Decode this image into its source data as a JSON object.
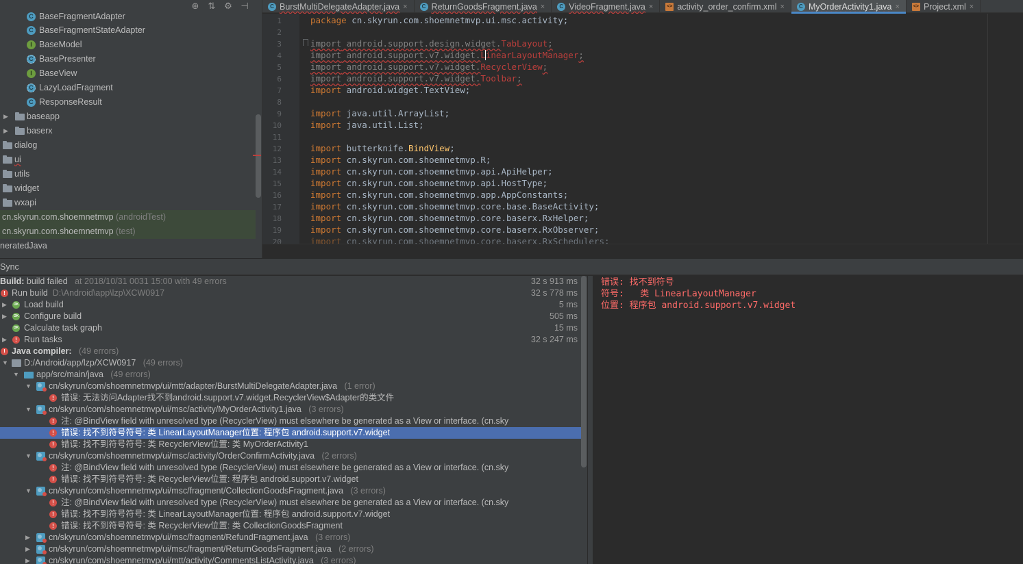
{
  "project_tree": {
    "toolbar_icons": [
      "target-icon",
      "collapse-icon",
      "gear-icon",
      "hide-icon"
    ],
    "items": [
      {
        "label": "BaseFragmentAdapter",
        "icon": "class-icon",
        "sub": ""
      },
      {
        "label": "BaseFragmentStateAdapter",
        "icon": "class-icon",
        "sub": ""
      },
      {
        "label": "BaseModel",
        "icon": "interface-icon",
        "sub": ""
      },
      {
        "label": "BasePresenter",
        "icon": "abstract-class-icon",
        "sub": ""
      },
      {
        "label": "BaseView",
        "icon": "interface-icon",
        "sub": ""
      },
      {
        "label": "LazyLoadFragment",
        "icon": "abstract-class-icon",
        "sub": ""
      },
      {
        "label": "ResponseResult",
        "icon": "class-icon",
        "sub": ""
      },
      {
        "label": "baseapp",
        "icon": "folder-icon",
        "sub": ""
      },
      {
        "label": "baserx",
        "icon": "folder-icon",
        "sub": ""
      },
      {
        "label": "dialog",
        "icon": "folder-icon",
        "sub": ""
      },
      {
        "label": "ui",
        "icon": "folder-icon",
        "sub": ""
      },
      {
        "label": "utils",
        "icon": "folder-icon",
        "sub": ""
      },
      {
        "label": "widget",
        "icon": "folder-icon",
        "sub": ""
      },
      {
        "label": "wxapi",
        "icon": "folder-icon",
        "sub": ""
      },
      {
        "label": "cn.skyrun.com.shoemnetmvp",
        "icon": "",
        "sub": "(androidTest)"
      },
      {
        "label": "cn.skyrun.com.shoemnetmvp",
        "icon": "",
        "sub": "(test)"
      },
      {
        "label": "neratedJava",
        "icon": "",
        "sub": ""
      }
    ]
  },
  "editor": {
    "tabs": [
      {
        "label": "BurstMultiDelegateAdapter.java",
        "icon": "class-icon",
        "active": false
      },
      {
        "label": "ReturnGoodsFragment.java",
        "icon": "class-icon",
        "active": false
      },
      {
        "label": "VideoFragment.java",
        "icon": "class-icon",
        "active": false
      },
      {
        "label": "activity_order_confirm.xml",
        "icon": "xml-icon",
        "active": false
      },
      {
        "label": "MyOrderActivity1.java",
        "icon": "class-icon",
        "active": true
      },
      {
        "label": "Project.xml",
        "icon": "xml-icon",
        "active": false
      }
    ],
    "close_glyph": "×",
    "line_numbers": [
      "1",
      "2",
      "3",
      "4",
      "5",
      "6",
      "7",
      "8",
      "9",
      "10",
      "11",
      "12",
      "13",
      "14",
      "15",
      "16",
      "17",
      "18",
      "19",
      "20"
    ],
    "code": {
      "l1_kw": "package",
      "l1": " cn.skyrun.com.shoemnetmvp.ui.msc.activity;",
      "l3_kw": "import",
      "l3": " android.support.design.widget.",
      "l3_err": "TabLayout",
      "l4_kw": "import",
      "l4": " android.support.v7.widget.",
      "l4_err": "LinearLayoutManager",
      "l5_kw": "import",
      "l5": " android.support.v7.widget.",
      "l5_err": "RecyclerView",
      "l6_kw": "import",
      "l6": " android.support.v7.widget.",
      "l6_err": "Toolbar",
      "l7_kw": "import",
      "l7": " android.widget.TextView;",
      "l9_kw": "import",
      "l9": " java.util.ArrayList;",
      "l10_kw": "import",
      "l10": " java.util.List;",
      "l12_kw": "import",
      "l12": " butterknife.",
      "l12_sym": "BindView",
      "l13_kw": "import",
      "l13": " cn.skyrun.com.shoemnetmvp.R;",
      "l14_kw": "import",
      "l14": " cn.skyrun.com.shoemnetmvp.api.ApiHelper;",
      "l15_kw": "import",
      "l15": " cn.skyrun.com.shoemnetmvp.api.HostType;",
      "l16_kw": "import",
      "l16": " cn.skyrun.com.shoemnetmvp.app.AppConstants;",
      "l17_kw": "import",
      "l17": " cn.skyrun.com.shoemnetmvp.core.base.BaseActivity;",
      "l18_kw": "import",
      "l18": " cn.skyrun.com.shoemnetmvp.core.baserx.RxHelper;",
      "l19_kw": "import",
      "l19": " cn.skyrun.com.shoemnetmvp.core.baserx.RxObserver;",
      "l20_kw": "import",
      "l20": " cn.skyrun.com.shoemnetmvp.core.baserx.RxSchedulers;"
    }
  },
  "build": {
    "header": "Sync",
    "rows": [
      {
        "label": "Build:",
        "rest": "build failed",
        "sub": "at 2018/10/31 0031 15:00   with 49 errors",
        "time": "32 s 913 ms"
      },
      {
        "label": "Run build",
        "sub": "D:\\Android\\app\\lzp\\XCW0917",
        "time": "32 s 778 ms"
      },
      {
        "label": "Load build",
        "sub": "",
        "time": "5 ms"
      },
      {
        "label": "Configure build",
        "sub": "",
        "time": "505 ms"
      },
      {
        "label": "Calculate task graph",
        "sub": "",
        "time": "15 ms"
      },
      {
        "label": "Run tasks",
        "sub": "",
        "time": "32 s 247 ms"
      },
      {
        "label": "Java compiler:",
        "sub": "(49 errors)",
        "time": ""
      },
      {
        "label": "D:/Android/app/lzp/XCW0917",
        "sub": "(49 errors)",
        "time": ""
      },
      {
        "label": "app/src/main/java",
        "sub": "(49 errors)",
        "time": ""
      },
      {
        "label": "cn/skyrun/com/shoemnetmvp/ui/mtt/adapter/BurstMultiDelegateAdapter.java",
        "sub": "(1 error)",
        "time": ""
      },
      {
        "label": "错误: 无法访问Adapter找不到android.support.v7.widget.RecyclerView$Adapter的类文件",
        "sub": "",
        "time": ""
      },
      {
        "label": "cn/skyrun/com/shoemnetmvp/ui/msc/activity/MyOrderActivity1.java",
        "sub": "(3 errors)",
        "time": ""
      },
      {
        "label": "注: @BindView field with unresolved type (RecyclerView) must elsewhere be generated as a View or interface. (cn.sky",
        "sub": "",
        "time": ""
      },
      {
        "label": "错误: 找不到符号符号:   类 LinearLayoutManager位置: 程序包 android.support.v7.widget",
        "sub": "",
        "time": ""
      },
      {
        "label": "错误: 找不到符号符号:   类 RecyclerView位置: 类 MyOrderActivity1",
        "sub": "",
        "time": ""
      },
      {
        "label": "cn/skyrun/com/shoemnetmvp/ui/msc/activity/OrderConfirmActivity.java",
        "sub": "(2 errors)",
        "time": ""
      },
      {
        "label": "注: @BindView field with unresolved type (RecyclerView) must elsewhere be generated as a View or interface. (cn.sky",
        "sub": "",
        "time": ""
      },
      {
        "label": "错误: 找不到符号符号:   类 RecyclerView位置: 程序包 android.support.v7.widget",
        "sub": "",
        "time": ""
      },
      {
        "label": "cn/skyrun/com/shoemnetmvp/ui/msc/fragment/CollectionGoodsFragment.java",
        "sub": "(3 errors)",
        "time": ""
      },
      {
        "label": "注: @BindView field with unresolved type (RecyclerView) must elsewhere be generated as a View or interface. (cn.sky",
        "sub": "",
        "time": ""
      },
      {
        "label": "错误: 找不到符号符号:   类 LinearLayoutManager位置: 程序包 android.support.v7.widget",
        "sub": "",
        "time": ""
      },
      {
        "label": "错误: 找不到符号符号:   类 RecyclerView位置: 类 CollectionGoodsFragment",
        "sub": "",
        "time": ""
      },
      {
        "label": "cn/skyrun/com/shoemnetmvp/ui/msc/fragment/RefundFragment.java",
        "sub": "(3 errors)",
        "time": ""
      },
      {
        "label": "cn/skyrun/com/shoemnetmvp/ui/msc/fragment/ReturnGoodsFragment.java",
        "sub": "(2 errors)",
        "time": ""
      },
      {
        "label": "cn/skyrun/com/shoemnetmvp/ui/mtt/activity/CommentsListActivity.java",
        "sub": "(3 errors)",
        "time": ""
      }
    ]
  },
  "console": {
    "lines": [
      "错误: 找不到符号",
      "符号:   类 LinearLayoutManager",
      "位置: 程序包 android.support.v7.widget"
    ]
  },
  "colors": {
    "error": "#bc3f3c",
    "selection": "#4b6eaf",
    "keyword": "#cc7832",
    "console_error": "#ff6b68"
  }
}
